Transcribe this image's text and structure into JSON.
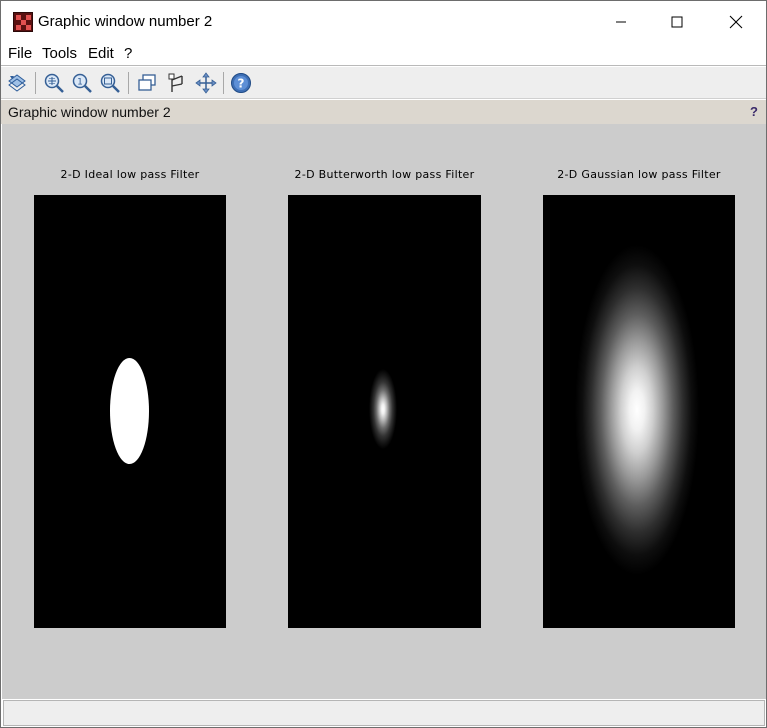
{
  "window": {
    "title": "Graphic window number 2",
    "controls": {
      "minimize": "minimize-icon",
      "maximize": "maximize-icon",
      "close": "close-icon"
    }
  },
  "menu": [
    {
      "label": "File"
    },
    {
      "label": "Tools"
    },
    {
      "label": "Edit"
    },
    {
      "label": "?"
    }
  ],
  "toolbar": {
    "buttons": [
      {
        "icon": "rotate-icon"
      },
      {
        "icon": "zoom-grid-icon"
      },
      {
        "icon": "zoom-original-icon"
      },
      {
        "icon": "zoom-out-icon"
      },
      {
        "icon": "new-window-icon"
      },
      {
        "icon": "datatip-icon"
      },
      {
        "icon": "pan-icon"
      },
      {
        "icon": "help-icon"
      }
    ]
  },
  "infobar": {
    "text": "Graphic window number 2",
    "help": "?"
  },
  "plots": [
    {
      "title": "2-D Ideal low pass Filter"
    },
    {
      "title": "2-D Butterworth low pass Filter"
    },
    {
      "title": "2-D Gaussian low pass Filter"
    }
  ],
  "colors": {
    "canvas": "#cccccc",
    "infobar": "#dcd7cf",
    "plot_background": "#000000"
  }
}
